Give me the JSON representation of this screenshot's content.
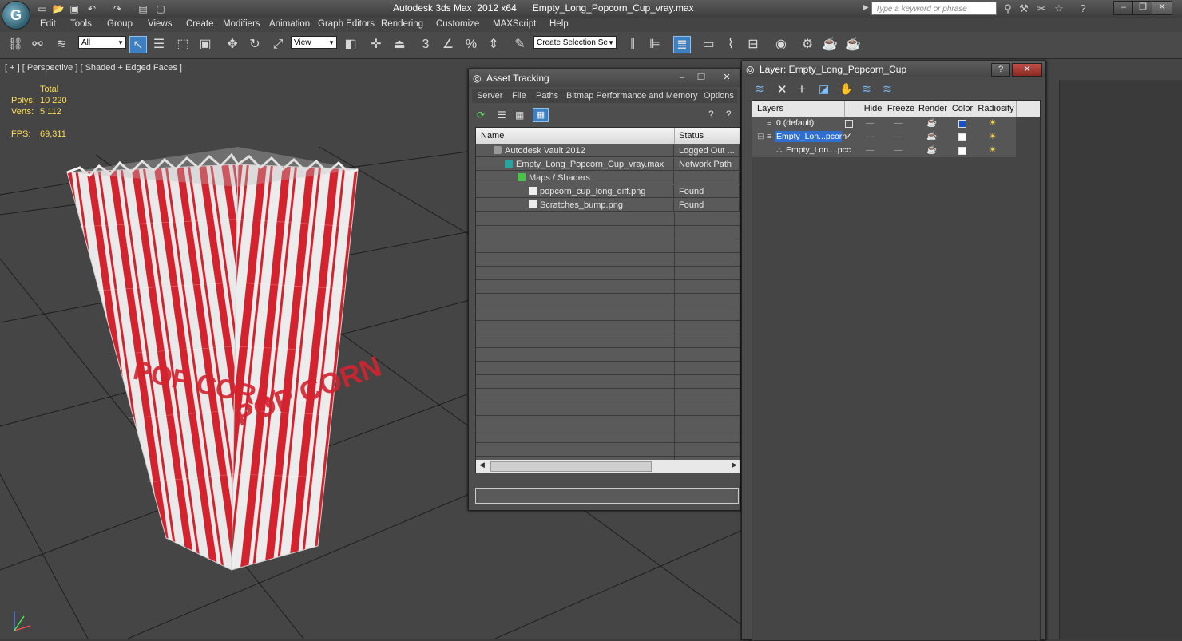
{
  "app": {
    "title": "Autodesk 3ds Max  2012 x64      Empty_Long_Popcorn_Cup_vray.max",
    "logo": "3ds-max-logo",
    "search_placeholder": "Type a keyword or phrase"
  },
  "menu": [
    "Edit",
    "Tools",
    "Group",
    "Views",
    "Create",
    "Modifiers",
    "Animation",
    "Graph Editors",
    "Rendering",
    "Customize",
    "MAXScript",
    "Help"
  ],
  "toolbar": {
    "filter": "All",
    "ref_coord": "View",
    "selection_set": "Create Selection Se"
  },
  "viewport": {
    "label": "[ + ] [ Perspective ] [ Shaded + Edged Faces ]",
    "stats": {
      "header": "Total",
      "polys_label": "Polys:",
      "polys": "10 220",
      "verts_label": "Verts:",
      "verts": "5 112",
      "fps_label": "FPS:",
      "fps": "69,311"
    },
    "cup_text": "POP CORN"
  },
  "asset_tracking": {
    "title": "Asset Tracking",
    "menu": [
      "Server",
      "File",
      "Paths",
      "Bitmap Performance and Memory",
      "Options"
    ],
    "columns": [
      "Name",
      "Status"
    ],
    "rows": [
      {
        "name": "Autodesk Vault 2012",
        "status": "Logged Out ..."
      },
      {
        "name": "Empty_Long_Popcorn_Cup_vray.max",
        "status": "Network Path"
      },
      {
        "name": "Maps / Shaders",
        "status": ""
      },
      {
        "name": "popcorn_cup_long_diff.png",
        "status": "Found"
      },
      {
        "name": "Scratches_bump.png",
        "status": "Found"
      }
    ]
  },
  "layer_manager": {
    "title": "Layer: Empty_Long_Popcorn_Cup",
    "columns": [
      "Layers",
      "Hide",
      "Freeze",
      "Render",
      "Color",
      "Radiosity"
    ],
    "rows": [
      {
        "name": "0 (default)"
      },
      {
        "name": "Empty_Lon...pcorn"
      },
      {
        "name": "Empty_Lon....pcc"
      }
    ],
    "colors": {
      "default_layer": "#1a4fd0",
      "selected_bg": "#2f6fd1"
    }
  }
}
